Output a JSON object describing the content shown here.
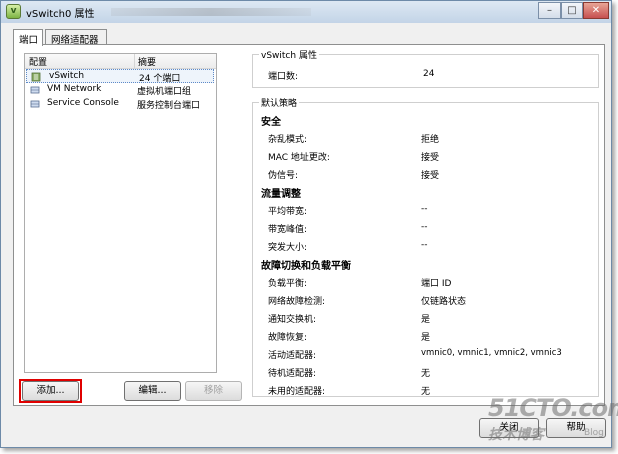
{
  "window": {
    "title": "vSwitch0 属性",
    "min": "–",
    "max": "□",
    "close": "✕"
  },
  "tabs": [
    "端口",
    "网络适配器"
  ],
  "list": {
    "headers": {
      "config": "配置",
      "summary": "摘要"
    },
    "rows": [
      {
        "name": "vSwitch",
        "summary": "24 个端口",
        "icon": "vswitch-icon"
      },
      {
        "name": "VM Network",
        "summary": "虚拟机端口组",
        "icon": "network-icon"
      },
      {
        "name": "Service Console",
        "summary": "服务控制台端口",
        "icon": "network-icon"
      }
    ]
  },
  "buttons": {
    "add": "添加...",
    "edit": "编辑...",
    "remove": "移除"
  },
  "vswitch_props": {
    "legend": "vSwitch 属性",
    "ports_label": "端口数:",
    "ports_value": "24"
  },
  "policy": {
    "legend": "默认策略",
    "security": {
      "title": "安全",
      "promiscuous_label": "杂乱模式:",
      "promiscuous_value": "拒绝",
      "mac_label": "MAC 地址更改:",
      "mac_value": "接受",
      "forged_label": "伪信号:",
      "forged_value": "接受"
    },
    "traffic": {
      "title": "流量调整",
      "avg_label": "平均带宽:",
      "avg_value": "--",
      "peak_label": "带宽峰值:",
      "peak_value": "--",
      "burst_label": "突发大小:",
      "burst_value": "--"
    },
    "failover": {
      "title": "故障切换和负载平衡",
      "lb_label": "负载平衡:",
      "lb_value": "端口 ID",
      "detect_label": "网络故障检测:",
      "detect_value": "仅链路状态",
      "notify_label": "通知交换机:",
      "notify_value": "是",
      "failback_label": "故障恢复:",
      "failback_value": "是",
      "active_label": "活动适配器:",
      "active_value": "vmnic0, vmnic1, vmnic2, vmnic3",
      "standby_label": "待机适配器:",
      "standby_value": "无",
      "unused_label": "未用的适配器:",
      "unused_value": "无"
    }
  },
  "footer": {
    "close_partial": "关闭",
    "help_partial": "帮助"
  },
  "watermark": {
    "line1": "51CTO.com",
    "line2": "技术博客",
    "line3": "Blog"
  }
}
